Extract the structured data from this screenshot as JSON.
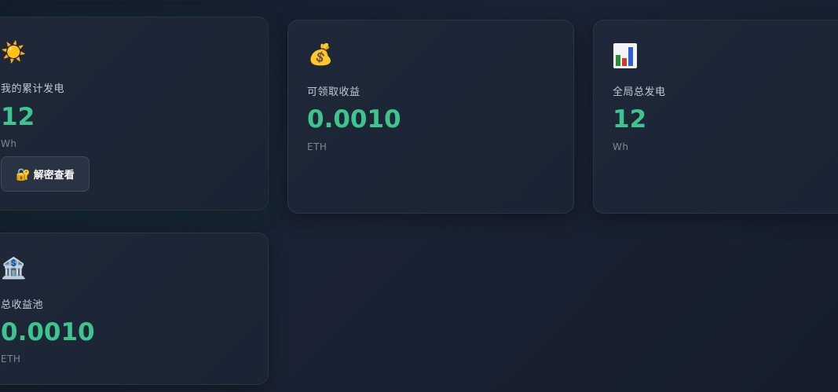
{
  "cards": [
    {
      "icon": "☀️",
      "icon_name": "sun-icon",
      "label": "我的累计发电",
      "value": "12",
      "unit": "Wh",
      "button": {
        "icon": "🔐",
        "icon_name": "lock-key-icon",
        "label": "解密查看"
      }
    },
    {
      "icon": "💰",
      "icon_name": "money-bag-icon",
      "label": "可领取收益",
      "value": "0.0010",
      "unit": "ETH"
    },
    {
      "icon_name": "bar-chart-icon",
      "label": "全局总发电",
      "value": "12",
      "unit": "Wh"
    },
    {
      "icon": "🏦",
      "icon_name": "bank-icon",
      "label": "总收益池",
      "value": "0.0010",
      "unit": "ETH"
    }
  ],
  "colors": {
    "accent": "#3ec48f",
    "background": "#141c2b",
    "card": "#1e2838"
  }
}
